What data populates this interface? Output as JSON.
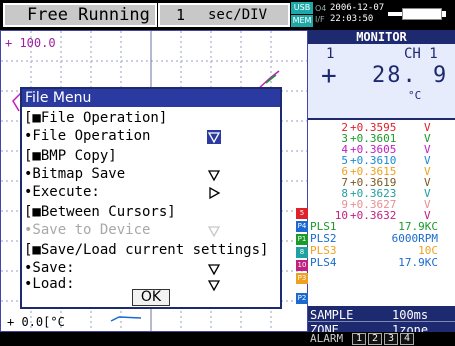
{
  "header": {
    "mode": "Free Running",
    "timebase_value": "1",
    "timebase_unit": "sec/DIV",
    "usb": "USB",
    "mem": "MEM",
    "of_top": "O4",
    "of_bot": "I/F",
    "date": "2006-12-07",
    "time": "22:03:50"
  },
  "graph": {
    "top_scale": "+ 100.0",
    "bottom_scale": "+  0.0[°C"
  },
  "monitor": {
    "title": "MONITOR",
    "ch_index": "1",
    "ch_label": "CH 1",
    "sign": "+",
    "value": "28. 9",
    "unit": "°C"
  },
  "channels": [
    {
      "n": "2",
      "v": "+0.3595",
      "u": "V",
      "color": "#e0202a"
    },
    {
      "n": "3",
      "v": "+0.3601",
      "u": "V",
      "color": "#1a9a2a"
    },
    {
      "n": "4",
      "v": "+0.3605",
      "u": "V",
      "color": "#c020c0"
    },
    {
      "n": "5",
      "v": "+0.3610",
      "u": "V",
      "color": "#1a8ad0"
    },
    {
      "n": "6",
      "v": "+0.3615",
      "u": "V",
      "color": "#f0a020"
    },
    {
      "n": "7",
      "v": "+0.3619",
      "u": "V",
      "color": "#7a5a20"
    },
    {
      "n": "8",
      "v": "+0.3623",
      "u": "V",
      "color": "#20a0a0"
    },
    {
      "n": "9",
      "v": "+0.3627",
      "u": "V",
      "color": "#e89090"
    },
    {
      "n": "10",
      "v": "+0.3632",
      "u": "V",
      "color": "#c02080"
    }
  ],
  "pulses": [
    {
      "n": "PLS1",
      "v": "17.9KC",
      "color": "#1a9a2a"
    },
    {
      "n": "PLS2",
      "v": "6000RPM",
      "color": "#1a6ad0"
    },
    {
      "n": "PLS3",
      "v": "10C",
      "color": "#f0a020"
    },
    {
      "n": "PLS4",
      "v": "17.9KC",
      "color": "#1a6ad0"
    }
  ],
  "sample": {
    "label1": "SAMPLE",
    "value1": "100ms",
    "label2": "ZONE",
    "value2": "1zone"
  },
  "alarm": {
    "label": "ALARM",
    "boxes": [
      "1",
      "2",
      "3",
      "4"
    ]
  },
  "tabs": [
    {
      "t": "5",
      "color": "#e0202a"
    },
    {
      "t": "P4",
      "color": "#1a6ad0"
    },
    {
      "t": "P1",
      "color": "#1a9a2a"
    },
    {
      "t": "8",
      "color": "#20a0a0"
    },
    {
      "t": "10",
      "color": "#c02080"
    },
    {
      "t": "P3",
      "color": "#f0a020"
    },
    {
      "t": "P2",
      "color": "#1a6ad0"
    }
  ],
  "menu": {
    "title": "File Menu",
    "file_op_header": "[■File Operation]",
    "file_op_item": "•File Operation",
    "bmp_header": "[■BMP Copy]",
    "bitmap_save": "•Bitmap Save",
    "execute": "•Execute:",
    "between_header": "[■Between Cursors]",
    "save_device": "•Save to Device",
    "saveload_header": "[■Save/Load current settings]",
    "save": "•Save:",
    "load": "•Load:",
    "ok": "OK"
  }
}
